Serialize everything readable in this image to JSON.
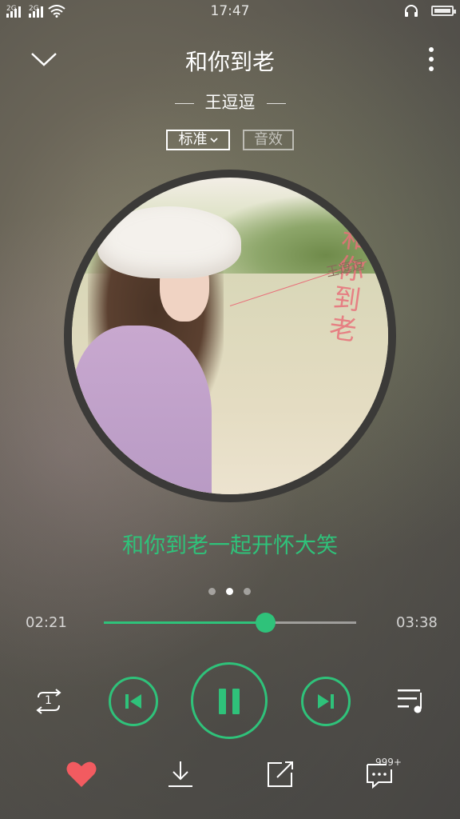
{
  "status_bar": {
    "signal1": "2G",
    "signal2": "2G",
    "time": "17:47",
    "icons": [
      "signal-icon",
      "signal-icon",
      "wifi-icon",
      "headphone-icon",
      "battery-icon"
    ]
  },
  "header": {
    "collapse_icon": "chevron-down-icon",
    "more_icon": "more-vertical-icon"
  },
  "song": {
    "title": "和你到老",
    "artist": "王逗逗"
  },
  "quality": {
    "label": "标准",
    "effect_label": "音效"
  },
  "cover": {
    "title_text": "和你到老",
    "artist_text": "王逗逗"
  },
  "lyric": "和你到老一起开怀大笑",
  "pager": {
    "count": 3,
    "active_index": 1
  },
  "playback": {
    "elapsed": "02:21",
    "duration": "03:38",
    "progress_fraction": 0.639
  },
  "controls": {
    "repeat_mode_number": "1",
    "icons": [
      "repeat-one-icon",
      "previous-icon",
      "pause-icon",
      "next-icon",
      "playlist-icon"
    ]
  },
  "bottom": {
    "comment_count": "999+",
    "icons": [
      "heart-icon",
      "download-icon",
      "share-icon",
      "comment-icon"
    ]
  },
  "colors": {
    "accent": "#2fc27a",
    "heart": "#f25b60"
  }
}
